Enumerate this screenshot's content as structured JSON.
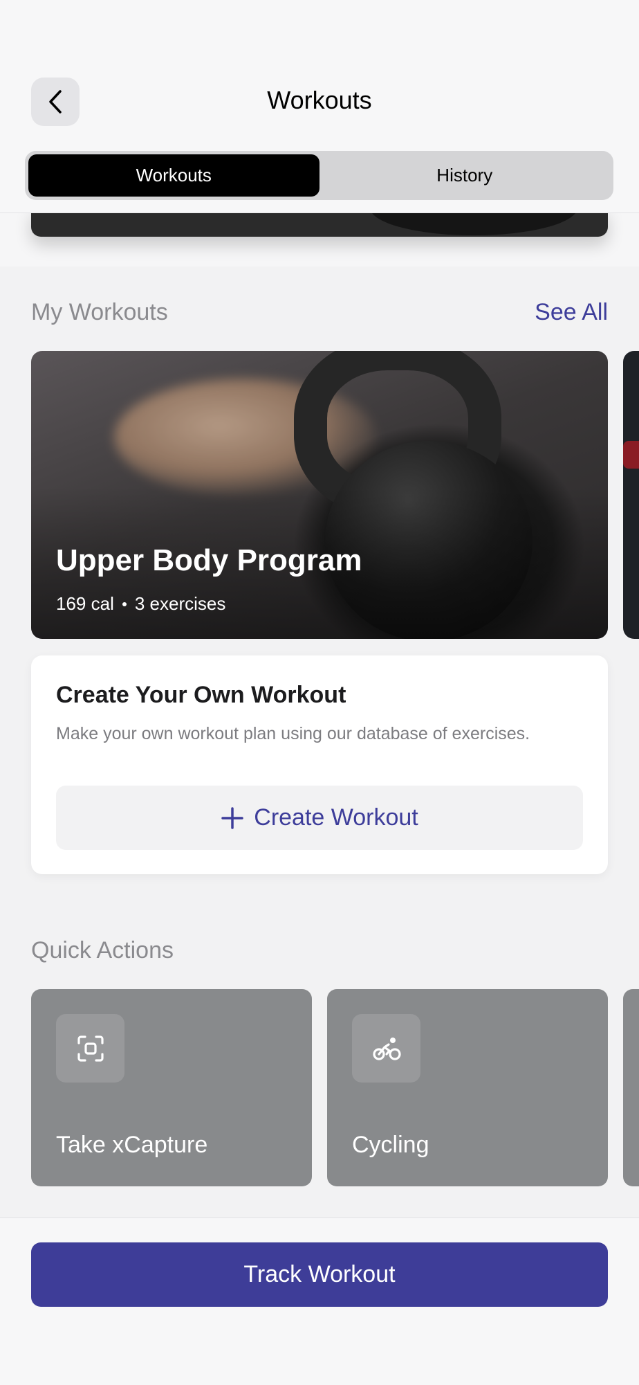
{
  "header": {
    "title": "Workouts",
    "tabs": [
      {
        "label": "Workouts",
        "active": true
      },
      {
        "label": "History",
        "active": false
      }
    ]
  },
  "my_workouts": {
    "section_title": "My Workouts",
    "see_all_label": "See All",
    "featured": {
      "title": "Upper Body Program",
      "calories": "169 cal",
      "exercises": "3 exercises"
    }
  },
  "create_workout": {
    "title": "Create Your Own Workout",
    "description": "Make your own workout plan using our database of exercises.",
    "button_label": "Create Workout"
  },
  "quick_actions": {
    "section_title": "Quick Actions",
    "items": [
      {
        "label": "Take xCapture",
        "icon": "scan-icon"
      },
      {
        "label": "Cycling",
        "icon": "cycling-icon"
      }
    ]
  },
  "footer": {
    "track_button_label": "Track Workout"
  },
  "colors": {
    "accent": "#3e3d98",
    "link": "#3d3d9a",
    "background": "#f2f2f3",
    "quick_action_card": "#888a8c"
  }
}
